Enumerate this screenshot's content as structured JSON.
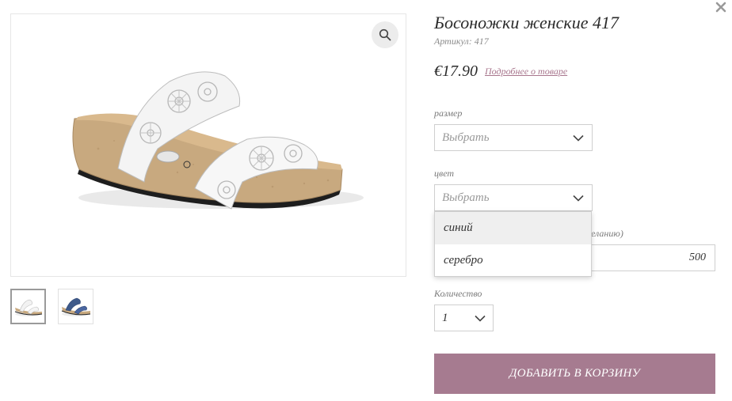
{
  "product": {
    "title": "Босоножки женские 417",
    "sku_label": "Артикул:",
    "sku_value": "417",
    "price": "€17.90",
    "more_link": "Подробнее о товаре"
  },
  "options": {
    "size": {
      "label": "размер",
      "value": "Выбрать"
    },
    "color": {
      "label": "цвет",
      "value": "Выбрать",
      "menu": [
        "синий",
        "серебро"
      ],
      "highlighted": "синий"
    },
    "amount": {
      "label_partial": "желанию)",
      "value": "500"
    },
    "quantity": {
      "label": "Количество",
      "value": "1"
    }
  },
  "actions": {
    "add_to_cart": "ДОБАВИТЬ В КОРЗИНУ"
  },
  "icons": {
    "close": "close-icon",
    "zoom": "magnifier-icon",
    "chevron": "chevron-down-icon"
  },
  "colors": {
    "accent": "#a67b90",
    "link": "#a8768d",
    "border": "#cfcfcf",
    "highlight": "#efefef"
  }
}
